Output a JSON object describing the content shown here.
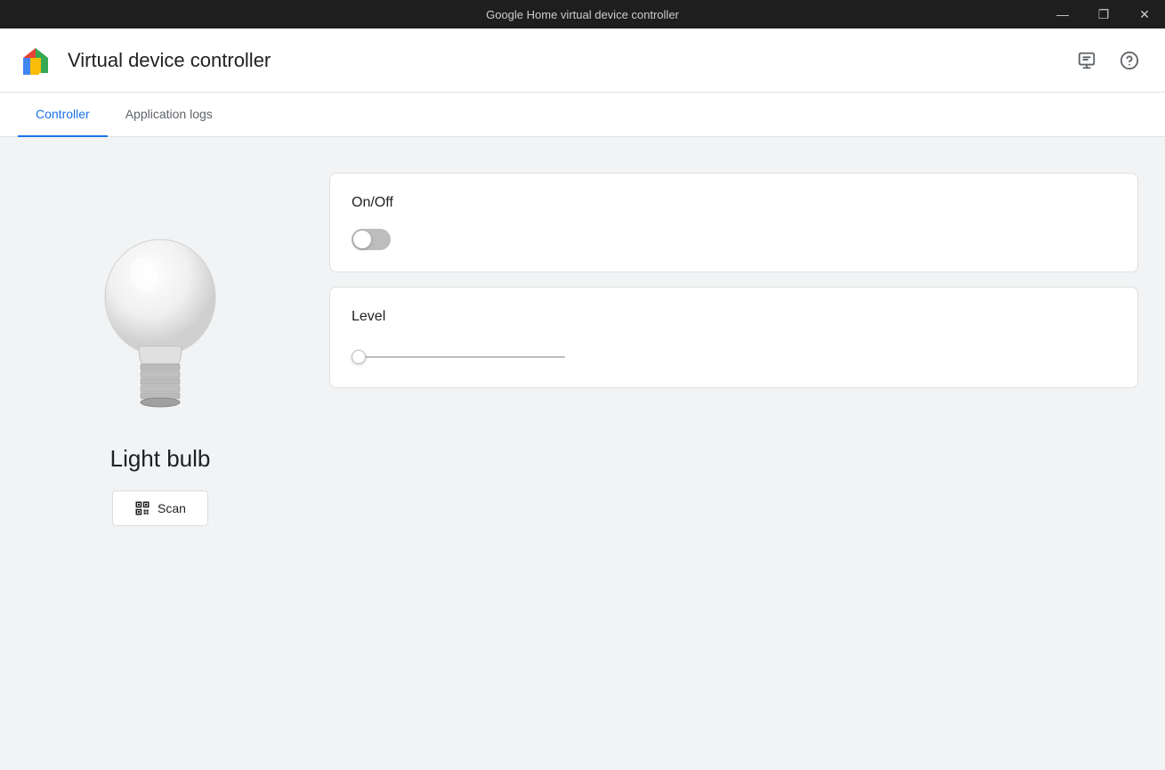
{
  "titleBar": {
    "title": "Google Home virtual device controller",
    "minimizeBtn": "—",
    "maximizeBtn": "❐",
    "closeBtn": "✕"
  },
  "header": {
    "appTitle": "Virtual device controller",
    "feedbackIcon": "💬",
    "helpIcon": "?"
  },
  "tabs": [
    {
      "id": "controller",
      "label": "Controller",
      "active": true
    },
    {
      "id": "application-logs",
      "label": "Application logs",
      "active": false
    }
  ],
  "device": {
    "name": "Light bulb",
    "scanButtonLabel": "Scan"
  },
  "controls": {
    "onOff": {
      "label": "On/Off",
      "value": false
    },
    "level": {
      "label": "Level",
      "value": 0,
      "min": 0,
      "max": 100
    }
  }
}
